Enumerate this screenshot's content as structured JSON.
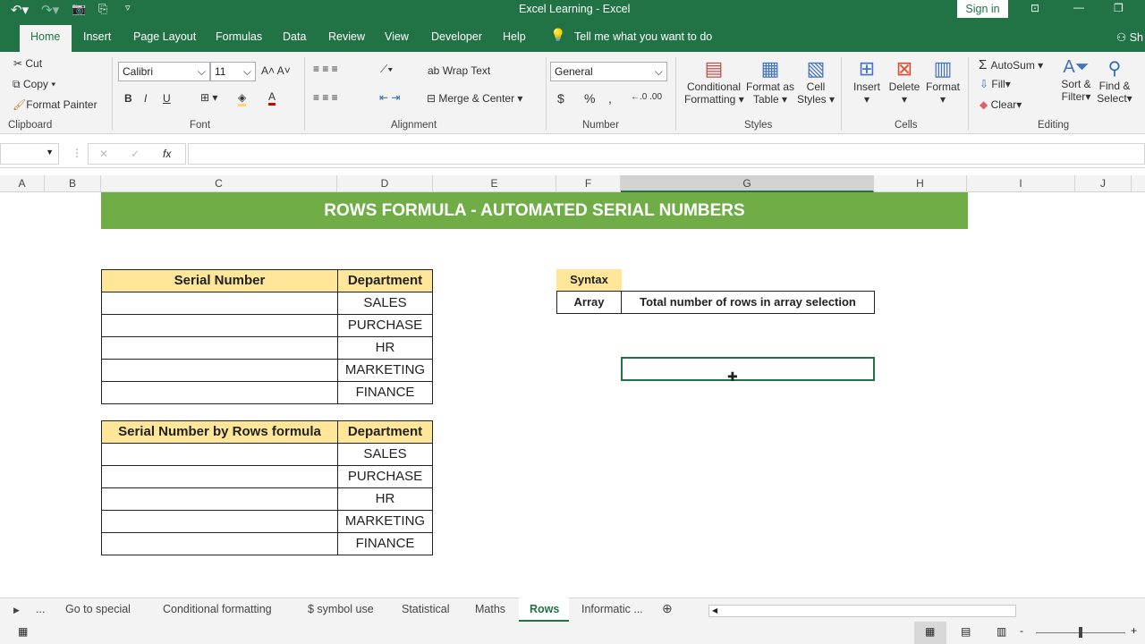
{
  "window": {
    "title": "Excel Learning  -  Excel",
    "sign_in": "Sign in"
  },
  "ribbon_tabs": [
    "Home",
    "Insert",
    "Page Layout",
    "Formulas",
    "Data",
    "Review",
    "View",
    "Developer",
    "Help"
  ],
  "tell_me": "Tell me what you want to do",
  "share": "Sh",
  "clipboard": {
    "cut": "Cut",
    "copy": "Copy",
    "painter": "Format Painter",
    "label": "Clipboard"
  },
  "font": {
    "name": "Calibri",
    "size": "11",
    "label": "Font",
    "bold": "B",
    "italic": "I",
    "underline": "U"
  },
  "alignment": {
    "wrap": "Wrap Text",
    "merge": "Merge & Center",
    "label": "Alignment"
  },
  "number": {
    "format": "General",
    "currency": "$",
    "percent": "%",
    "comma": ",",
    "label": "Number"
  },
  "styles": {
    "cond": "Conditional",
    "cond2": "Formatting",
    "fat": "Format as",
    "fat2": "Table",
    "cell": "Cell",
    "cell2": "Styles",
    "label": "Styles"
  },
  "cells": {
    "insert": "Insert",
    "delete": "Delete",
    "format": "Format",
    "label": "Cells"
  },
  "editing": {
    "autosum": "AutoSum",
    "fill": "Fill",
    "clear": "Clear",
    "sort": "Sort &",
    "sort2": "Filter",
    "find": "Find &",
    "find2": "Select",
    "label": "Editing"
  },
  "formula_bar": {
    "name_box": "",
    "fx": "fx",
    "value": ""
  },
  "columns": [
    "A",
    "B",
    "C",
    "D",
    "E",
    "F",
    "G",
    "H",
    "I",
    "J"
  ],
  "sheet": {
    "title": "ROWS FORMULA - AUTOMATED SERIAL NUMBERS",
    "table1": {
      "headers": [
        "Serial Number",
        "Department"
      ],
      "departments": [
        "SALES",
        "PURCHASE",
        "HR",
        "MARKETING",
        "FINANCE"
      ]
    },
    "table2": {
      "headers": [
        "Serial Number by Rows formula",
        "Department"
      ],
      "departments": [
        "SALES",
        "PURCHASE",
        "HR",
        "MARKETING",
        "FINANCE"
      ]
    },
    "syntax": {
      "header": "Syntax",
      "arg": "Array",
      "desc": "Total number of rows in array selection"
    }
  },
  "sheet_tabs": [
    "...",
    "Go to special",
    "Conditional formatting",
    "$ symbol use",
    "Statistical",
    "Maths",
    "Rows",
    "Informatic ..."
  ],
  "active_sheet": "Rows",
  "colors": {
    "excel_green": "#217346",
    "title_fill": "#70ad47",
    "header_fill": "#ffe699"
  }
}
